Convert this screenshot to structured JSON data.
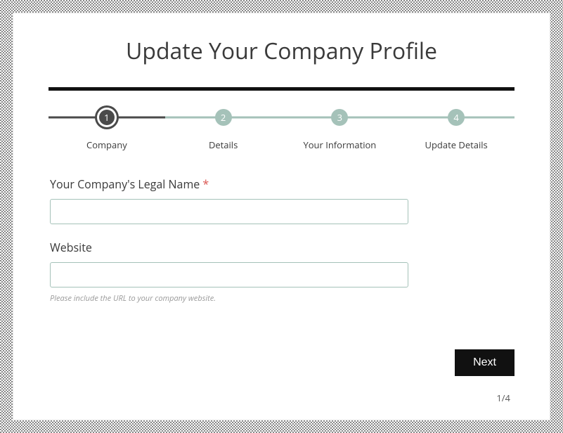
{
  "title": "Update Your Company Profile",
  "steps": [
    {
      "num": "1",
      "label": "Company",
      "active": true
    },
    {
      "num": "2",
      "label": "Details",
      "active": false
    },
    {
      "num": "3",
      "label": "Your Information",
      "active": false
    },
    {
      "num": "4",
      "label": "Update Details",
      "active": false
    }
  ],
  "fields": {
    "company_name": {
      "label": "Your Company's Legal Name",
      "required_mark": "*",
      "value": ""
    },
    "website": {
      "label": "Website",
      "value": "",
      "help": "Please include the URL to your company website."
    }
  },
  "actions": {
    "next": "Next"
  },
  "pager": "1/4"
}
